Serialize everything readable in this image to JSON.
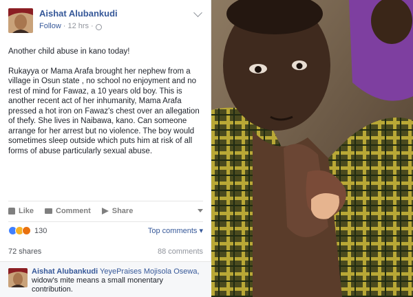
{
  "post": {
    "author": "Aishat Alubankudi",
    "follow_label": "Follow",
    "separator": "·",
    "time": "12 hrs",
    "paragraphs": [
      "Another child abuse in kano today!",
      "Rukayya or Mama Arafa brought her nephew from a village in Osun state , no school no enjoyment and no rest of mind for Fawaz, a 10 years old boy. This is another recent act of her inhumanity, Mama Arafa pressed a hot iron on Fawaz's chest over an allegation of thefy. She lives in Naibawa, kano. Can someone arrange for her arrest but no violence. The boy would sometimes sleep outside which puts him at risk of all forms of abuse particularly sexual abuse."
    ]
  },
  "actions": {
    "like": "Like",
    "comment": "Comment",
    "share": "Share"
  },
  "reactions": {
    "count": "130",
    "top_comments": "Top comments ▾"
  },
  "stats": {
    "shares": "72 shares",
    "comments": "88 comments"
  },
  "comment": {
    "author": "Aishat Alubankudi",
    "mention": "YeyePraises Mojisola Osewa,",
    "text": "widow's mite means a small monentary contribution."
  },
  "colors": {
    "link": "#365899",
    "muted": "#90949c",
    "like_blue": "#4080ff"
  }
}
